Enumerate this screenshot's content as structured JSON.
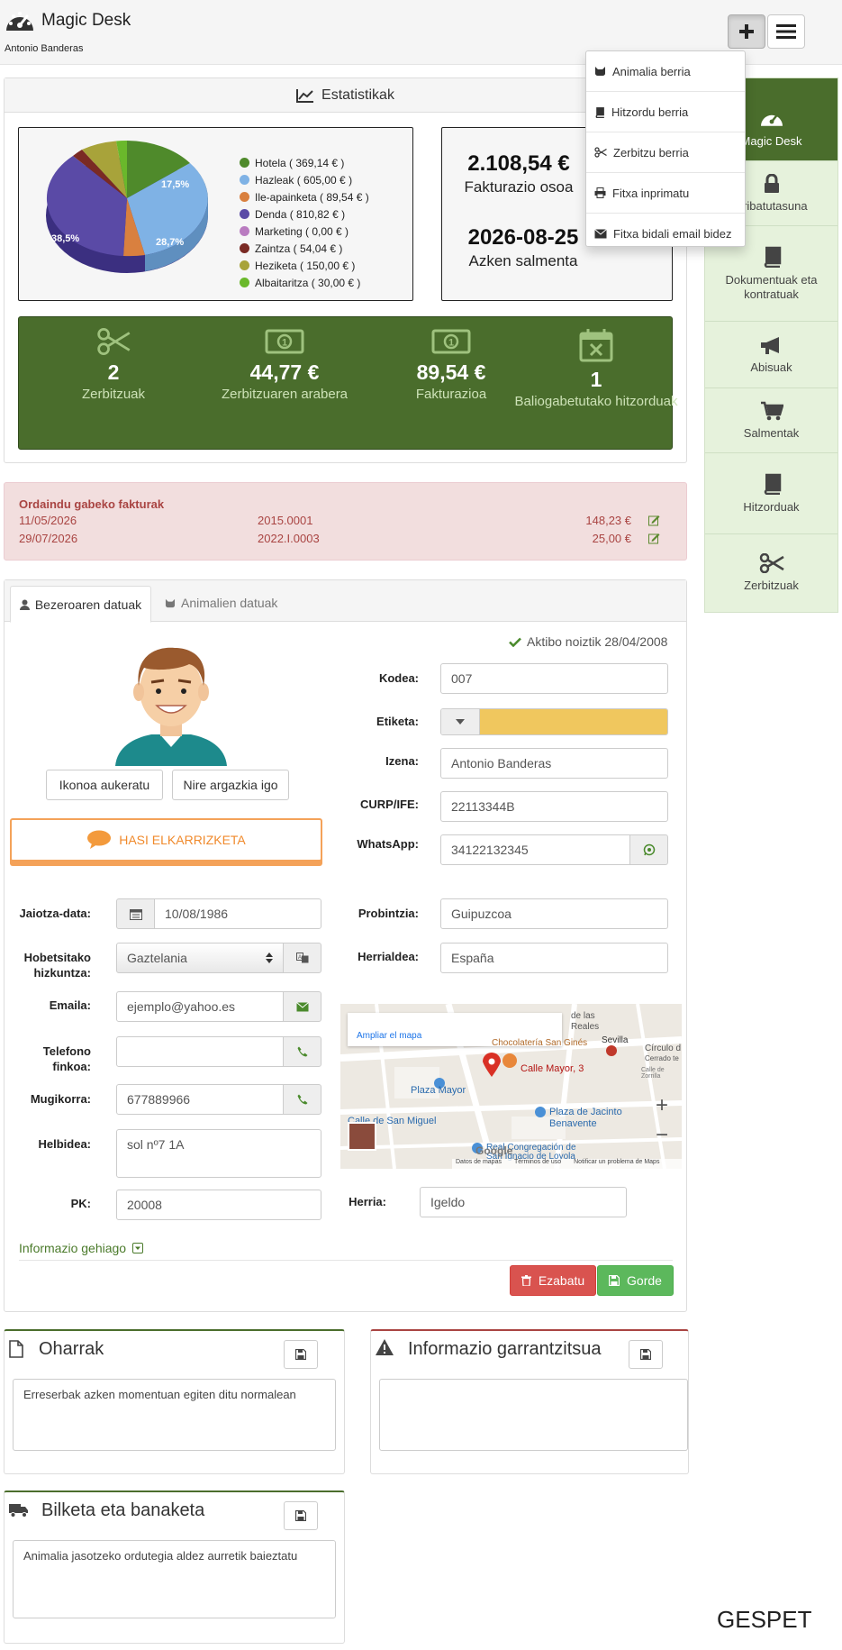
{
  "header": {
    "app_title": "Magic Desk",
    "user_name": "Antonio Banderas"
  },
  "dropdown": {
    "items": [
      {
        "icon": "cat-icon",
        "label": "Animalia berria"
      },
      {
        "icon": "book-icon",
        "label": "Hitzordu berria"
      },
      {
        "icon": "scissors-icon",
        "label": "Zerbitzu berria"
      },
      {
        "icon": "print-icon",
        "label": "Fitxa inprimatu"
      },
      {
        "icon": "envelope-icon",
        "label": "Fitxa bidali email bidez"
      }
    ]
  },
  "sidebar": {
    "items": [
      {
        "icon": "dashboard-icon",
        "label": "Magic Desk"
      },
      {
        "icon": "lock-icon",
        "label": "Pribatutasuna"
      },
      {
        "icon": "book-icon",
        "label": "Dokumentuak eta kontratuak"
      },
      {
        "icon": "megaphone-icon",
        "label": "Abisuak"
      },
      {
        "icon": "cart-icon",
        "label": "Salmentak"
      },
      {
        "icon": "book-icon",
        "label": "Hitzorduak"
      },
      {
        "icon": "scissors-icon",
        "label": "Zerbitzuak"
      }
    ]
  },
  "stats": {
    "title": "Estatistikak",
    "legend": [
      {
        "label": "Hotela ( 369,14 € )",
        "color": "#4f8a2b"
      },
      {
        "label": "Hazleak ( 605,00 € )",
        "color": "#7fb2e5"
      },
      {
        "label": "Ile-apainketa ( 89,54 € )",
        "color": "#d9803f"
      },
      {
        "label": "Denda ( 810,82 € )",
        "color": "#5a4aa6"
      },
      {
        "label": "Marketing ( 0,00 € )",
        "color": "#b97bc0"
      },
      {
        "label": "Zaintza ( 54,04 € )",
        "color": "#7a2a24"
      },
      {
        "label": "Heziketa ( 150,00 € )",
        "color": "#a8a33a"
      },
      {
        "label": "Albaitaritza ( 30,00 € )",
        "color": "#6ab82b"
      }
    ],
    "pie_labels": {
      "a": "17,5%",
      "b": "28,7%",
      "c": "38,5%"
    },
    "total_value": "2.108,54 €",
    "total_label": "Fakturazio osoa",
    "last_sale_value": "2026-08-25",
    "last_sale_label": "Azken salmenta",
    "summary": [
      {
        "icon": "scissors-icon",
        "value": "2",
        "label": "Zerbitzuak"
      },
      {
        "icon": "money-icon",
        "value": "44,77 €",
        "label": "Zerbitzuaren arabera"
      },
      {
        "icon": "money-icon",
        "value": "89,54 €",
        "label": "Fakturazioa"
      },
      {
        "icon": "calendar-x-icon",
        "value": "1",
        "label": "Baliogabetutako hitzorduak"
      }
    ]
  },
  "unpaid": {
    "title": "Ordaindu gabeko fakturak",
    "rows": [
      {
        "date": "11/05/2026",
        "number": "2015.0001",
        "amount": "148,23 €"
      },
      {
        "date": "29/07/2026",
        "number": "2022.I.0003",
        "amount": "25,00 €"
      }
    ]
  },
  "tabs": [
    {
      "icon": "user-icon",
      "label": "Bezeroaren datuak"
    },
    {
      "icon": "cat-icon",
      "label": "Animalien datuak"
    }
  ],
  "client": {
    "active_since": "Aktibo noiztik 28/04/2008",
    "change_icon_btn": "Ikonoa aukeratu",
    "upload_photo_btn": "Nire argazkia igo",
    "chat_btn": "HASI ELKARRIZKETA",
    "tag_color": "#f0c75e",
    "fields": {
      "code_label": "Kodea:",
      "code": "007",
      "tag_label": "Etiketa:",
      "name_label": "Izena:",
      "name": "Antonio Banderas",
      "curp_label": "CURP/IFE:",
      "curp": "22113344B",
      "whatsapp_label": "WhatsApp:",
      "whatsapp": "34122132345",
      "birth_label": "Jaiotza-data:",
      "birth": "10/08/1986",
      "province_label": "Probintzia:",
      "province": "Guipuzcoa",
      "lang_label": "Hobetsitako hizkuntza:",
      "lang": "Gaztelania",
      "country_label": "Herrialdea:",
      "country": "España",
      "email_label": "Emaila:",
      "email": "ejemplo@yahoo.es",
      "landline_label": "Telefono finkoa:",
      "landline": "",
      "mobile_label": "Mugikorra:",
      "mobile": "677889966",
      "address_label": "Helbidea:",
      "address": "sol nº7 1A",
      "zip_label": "PK:",
      "zip": "20008",
      "town_label": "Herria:",
      "town": "Igeldo"
    },
    "more_info": "Informazio gehiago",
    "delete_btn": "Ezabatu",
    "save_btn": "Gorde"
  },
  "map": {
    "enlarge_link": "Ampliar el mapa",
    "marker_label": "Calle Mayor, 3",
    "places": [
      "de las",
      "Reales",
      "Chocolatería San Ginés",
      "Sevilla",
      "Círculo d",
      "Cerrado te",
      "Calle de Zorrilla",
      "Plaza Mayor",
      "Plaza de Jacinto",
      "Benavente",
      "Calle de San Miguel",
      "Real Congregación de",
      "San Ignacio de Loyola"
    ],
    "footer": [
      "Datos de mapas",
      "Términos de uso",
      "Notificar un problema de Maps"
    ],
    "brand": "Google"
  },
  "notes": {
    "notes_title": "Oharrak",
    "notes_text": "Erreserbak azken momentuan egiten ditu normalean",
    "important_title": "Informazio garrantzitsua",
    "important_text": "",
    "pickup_title": "Bilketa eta banaketa",
    "pickup_text": "Animalia jasotzeko ordutegia aldez aurretik baieztatu"
  },
  "footer_logo": "GESPET"
}
